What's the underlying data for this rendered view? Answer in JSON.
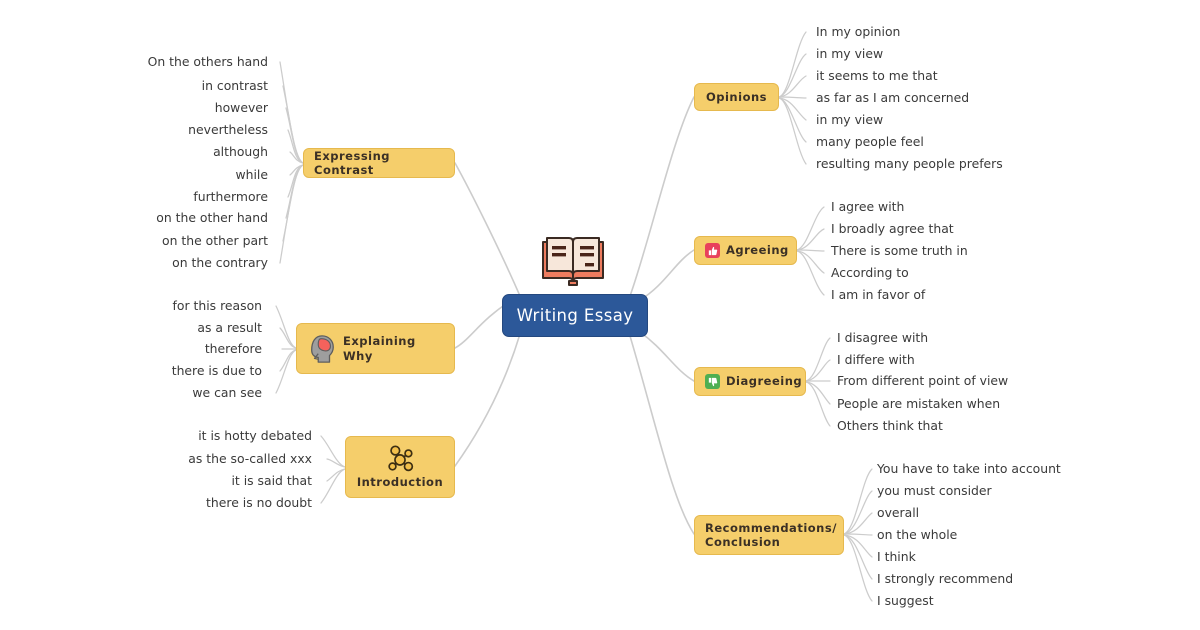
{
  "map": {
    "title": "Writing Essay",
    "colors": {
      "center_fill": "#2C5899",
      "center_text": "#FFFFFF",
      "branch_fill": "#F5CE6B",
      "branch_border": "#E6B94E",
      "branch_text": "#3B3025",
      "leaf_text": "#3A3A3A",
      "connector": "#CCCCCC",
      "thumb_up_chip": "#E8415C",
      "thumb_down_chip": "#4FAF52",
      "book_cover": "#EE7C5F",
      "book_page": "#F7E7DA",
      "brain": "#F4625C",
      "head": "#9E9E9E",
      "molecule": "#F3C04B"
    },
    "center_icon": "open-book-icon"
  },
  "branches": [
    {
      "id": "expressing-contrast",
      "label": "Expressing Contrast",
      "icon": null,
      "side": "left",
      "items": [
        "On the others hand",
        "in contrast",
        "however",
        "nevertheless",
        "although",
        "while",
        "furthermore",
        "on the other hand",
        "on the other part",
        "on the contrary"
      ]
    },
    {
      "id": "explaining-why",
      "label": "Explaining Why",
      "icon": "brain-head-icon",
      "side": "left",
      "items": [
        "for this reason",
        "as a result",
        "therefore",
        "there is due to",
        "we can see"
      ]
    },
    {
      "id": "introduction",
      "label": "Introduction",
      "icon": "molecule-network-icon",
      "side": "left",
      "items": [
        "it is hotty debated",
        "as the so-called xxx",
        "it is said that",
        "there is no doubt"
      ]
    },
    {
      "id": "opinions",
      "label": "Opinions",
      "icon": null,
      "side": "right",
      "items": [
        "In my opinion",
        "in my view",
        "it seems to me that",
        "as far as I am concerned",
        "in my view",
        "many people feel",
        "resulting many people prefers"
      ]
    },
    {
      "id": "agreeing",
      "label": "Agreeing",
      "icon": "thumbs-up-icon",
      "side": "right",
      "items": [
        "I agree with",
        "I broadly agree that",
        "There is some truth in",
        "According to",
        "I am in favor of"
      ]
    },
    {
      "id": "diagreeing",
      "label": "Diagreeing",
      "icon": "thumbs-down-icon",
      "side": "right",
      "items": [
        "I disagree with",
        "I differe with",
        "From different point of view",
        "People are mistaken when",
        "Others think that"
      ]
    },
    {
      "id": "recommendations-conclusion",
      "label": "Recommendations/\nConclusion",
      "icon": null,
      "side": "right",
      "items": [
        "You have to take into account",
        "you must consider",
        "overall",
        "on the whole",
        "I think",
        "I strongly recommend",
        "I suggest"
      ]
    }
  ]
}
